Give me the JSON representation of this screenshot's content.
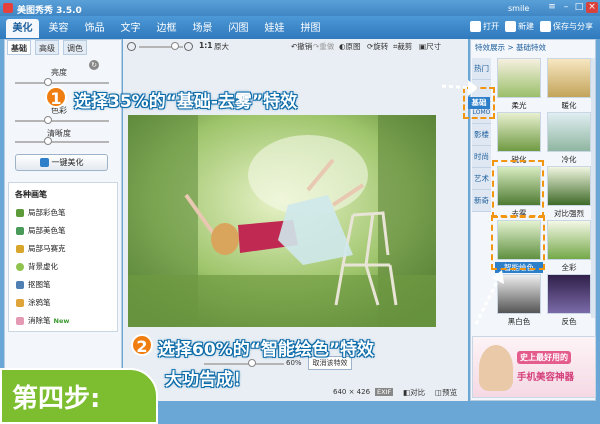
{
  "app": {
    "title": "美图秀秀 3.5.0",
    "user": "smile"
  },
  "nav": {
    "tabs": [
      "美化",
      "美容",
      "饰品",
      "文字",
      "边框",
      "场景",
      "闪图",
      "娃娃",
      "拼图"
    ],
    "active": "美化",
    "open": "打开",
    "new": "新建",
    "save_share": "保存与分享"
  },
  "left": {
    "tabs": [
      "基础",
      "高级",
      "调色"
    ],
    "sliders": [
      "亮度",
      "色彩",
      "清晰度"
    ],
    "one_key": "一键美化",
    "brush_title": "各种画笔",
    "brushes": [
      "局部彩色笔",
      "局部美色笔",
      "局部马赛克",
      "背景虚化",
      "抠图笔",
      "涂鸦笔",
      "消除笔"
    ],
    "brush_new_tag": "New"
  },
  "toolbar": {
    "zoom_text": "原大",
    "zoom_ratio": "1:1",
    "undo": "撤销",
    "redo": "重做",
    "original": "原图",
    "rotate": "旋转",
    "crop": "裁剪",
    "size": "尺寸"
  },
  "canvas": {
    "effect_pct": "60%",
    "cancel_effect": "取消该特效",
    "dimensions": "640 × 426",
    "exif": "EXIF",
    "compare": "对比",
    "preview": "预览"
  },
  "right": {
    "breadcrumb": "特效展示 > 基础特效",
    "categories": [
      "热门",
      "基础",
      "LOMO",
      "影楼",
      "时尚",
      "艺术",
      "新奇"
    ],
    "active_category": "基础",
    "effects": [
      "柔光",
      "暖化",
      "锐化",
      "冷化",
      "去雾",
      "对比强烈",
      "智能绘色",
      "全彩",
      "黑白色",
      "反色"
    ],
    "promo_line1": "史上最好用的",
    "promo_line2": "手机美容神器"
  },
  "overlay": {
    "num1": "1",
    "step1": "选择35%的“基础-去雾”特效",
    "num2": "2",
    "step2_line1": "选择60%的“智能绘色”特效",
    "step2_line2": "大功告成！",
    "step_label": "第四步:"
  },
  "colors": {
    "accent": "#2d7fca",
    "highlight": "#f29611",
    "step_bg": "#7cbe2f"
  }
}
